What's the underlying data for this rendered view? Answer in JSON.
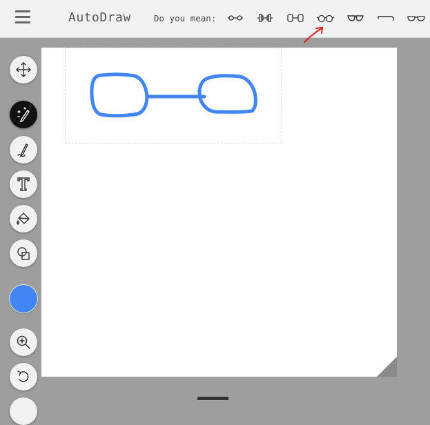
{
  "header": {
    "app_title": "AutoDraw",
    "suggestion_prompt": "Do you mean:",
    "suggestion_icons": [
      "glasses-connected-icon",
      "dumbbell-icon",
      "barbell-icon",
      "round-glasses-icon",
      "sunglasses-icon",
      "cane-icon",
      "eyeglasses-icon"
    ]
  },
  "toolbar": {
    "tools": [
      "move-tool",
      "autodraw-tool",
      "draw-tool",
      "type-tool",
      "fill-tool",
      "shape-tool"
    ],
    "active_tool": "autodraw-tool",
    "current_color": "#4285f4"
  },
  "colors": {
    "stroke": "#4285f4",
    "annotation": "#e02020"
  }
}
